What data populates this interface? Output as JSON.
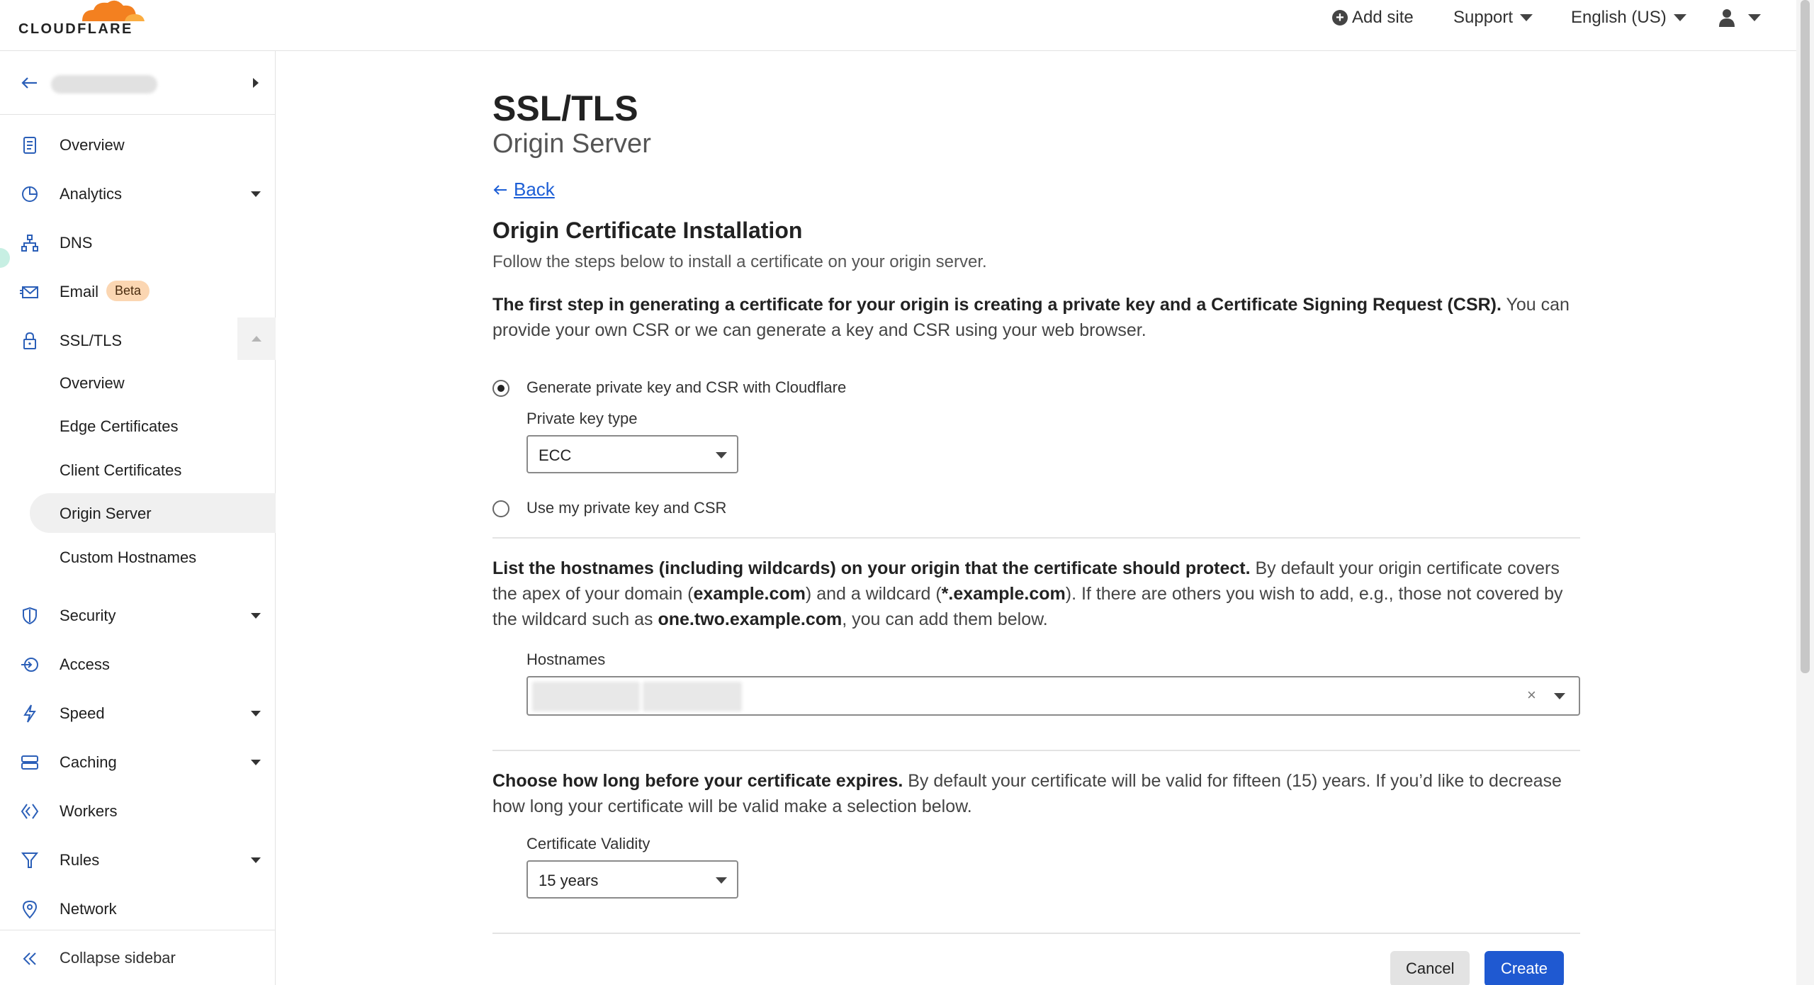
{
  "topbar": {
    "logo_text": "CLOUDFLARE",
    "add_site": "Add site",
    "support": "Support",
    "language": "English (US)"
  },
  "sidebar": {
    "items": [
      {
        "label": "Overview",
        "icon": "document-icon"
      },
      {
        "label": "Analytics",
        "icon": "pie-chart-icon"
      },
      {
        "label": "DNS",
        "icon": "network-tree-icon"
      },
      {
        "label": "Email",
        "icon": "envelope-icon",
        "badge": "Beta"
      },
      {
        "label": "SSL/TLS",
        "icon": "lock-icon"
      },
      {
        "label": "Security",
        "icon": "shield-icon"
      },
      {
        "label": "Access",
        "icon": "access-icon"
      },
      {
        "label": "Speed",
        "icon": "bolt-icon"
      },
      {
        "label": "Caching",
        "icon": "server-stack-icon"
      },
      {
        "label": "Workers",
        "icon": "workers-icon"
      },
      {
        "label": "Rules",
        "icon": "funnel-icon"
      },
      {
        "label": "Network",
        "icon": "location-pin-icon"
      }
    ],
    "ssl_subitems": [
      "Overview",
      "Edge Certificates",
      "Client Certificates",
      "Origin Server",
      "Custom Hostnames"
    ],
    "active_subitem": "Origin Server",
    "collapse_label": "Collapse sidebar"
  },
  "main": {
    "title": "SSL/TLS",
    "subtitle": "Origin Server",
    "back_label": "Back",
    "section_title": "Origin Certificate Installation",
    "section_subtitle": "Follow the steps below to install a certificate on your origin server.",
    "step1": {
      "bold": "The first step in generating a certificate for your origin is creating a private key and a Certificate Signing Request (CSR).",
      "rest": " You can provide your own CSR or we can generate a key and CSR using your web browser."
    },
    "radio_generate": "Generate private key and CSR with Cloudflare",
    "private_key_type_label": "Private key type",
    "private_key_type_value": "ECC",
    "radio_own": "Use my private key and CSR",
    "step2": {
      "bold": "List the hostnames (including wildcards) on your origin that the certificate should protect.",
      "t1": " By default your origin certificate covers the apex of your domain (",
      "b1": "example.com",
      "t2": ") and a wildcard (",
      "b2": "*.example.com",
      "t3": "). If there are others you wish to add, e.g., those not covered by the wildcard such as ",
      "b3": "one.two.example.com",
      "t4": ", you can add them below."
    },
    "hostnames_label": "Hostnames",
    "clear_symbol": "×",
    "step3": {
      "bold": "Choose how long before your certificate expires.",
      "rest": " By default your certificate will be valid for fifteen (15) years. If you’d like to decrease how long your certificate will be valid make a selection below."
    },
    "validity_label": "Certificate Validity",
    "validity_value": "15 years",
    "cancel_label": "Cancel",
    "create_label": "Create"
  },
  "colors": {
    "accent": "#1f59d1",
    "link": "#1c5ed6",
    "beta_badge": "#fbd6b2",
    "cloudflare_orange": "#f38020"
  }
}
